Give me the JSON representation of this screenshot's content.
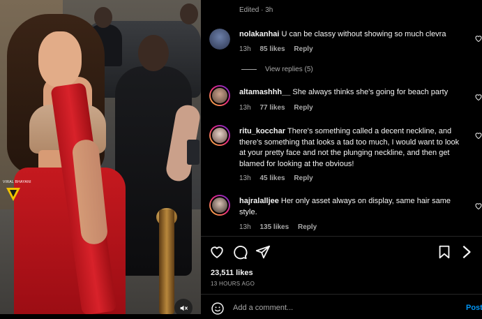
{
  "media": {
    "watermark_text": "VIRAL BHAYANI",
    "mute_icon": "speaker-muted-icon"
  },
  "post": {
    "edited_text": "Edited · 3h",
    "comments": [
      {
        "username": "nolakanhai",
        "text": "U can be classy without showing so much clevra",
        "time": "13h",
        "likes": "85 likes",
        "reply": "Reply",
        "view_replies": "View replies (5)"
      },
      {
        "username": "altamashhh__",
        "text": "She always thinks she's going for beach party",
        "time": "13h",
        "likes": "77 likes",
        "reply": "Reply"
      },
      {
        "username": "ritu_kocchar",
        "text": "There's something called a decent neckline, and there's something that looks a tad too much, I would want to look at your pretty face and not the plunging neckline, and then get blamed for looking at the obvious!",
        "time": "13h",
        "likes": "45 likes",
        "reply": "Reply"
      },
      {
        "username": "hajralalljee",
        "text": "Her only asset always on display, same hair same style.",
        "time": "13h",
        "likes": "135 likes",
        "reply": "Reply"
      }
    ],
    "like_count": "23,511 likes",
    "time_ago": "13 HOURS AGO",
    "add_comment_placeholder": "Add a comment...",
    "post_button": "Post",
    "colors": {
      "accent": "#0095f6",
      "muted": "#a8a8a8",
      "background": "#000000"
    }
  }
}
